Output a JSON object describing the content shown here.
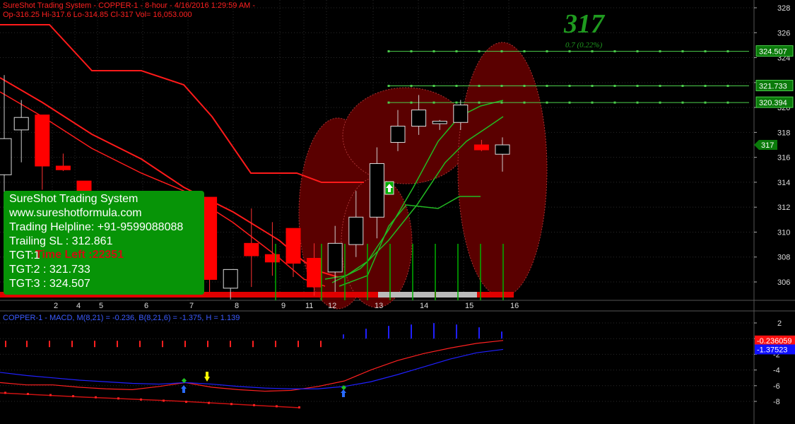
{
  "header": {
    "line1": "SureShot Trading System - COPPER-1 - 8-hour  - 4/16/2016 1:29:59 AM -",
    "line2": "Op-316.25  Hi-317.6  Lo-314.85  Cl-317  Vol= 16,053.000"
  },
  "macd_header": "COPPER-1 - MACD, M(8,21) = -0.236, B(8,21,6) = -1.375, H = 1.139",
  "big_price": "317",
  "big_change": "0.7  (0.22%)",
  "info_box": {
    "title": "SureShot Trading System",
    "website": "www.sureshotformula.com",
    "helpline": "Trading Helpline: +91-9599088088",
    "trailing_sl": "Trailing SL : 312.861",
    "tgt1": "TGT:1",
    "tgt2": "TGT:2 : 321.733",
    "tgt3": "TGT:3 : 324.507",
    "time_left": "Time Left :22351"
  },
  "colors": {
    "bullish": "#00aa00",
    "bearish": "#ff0000",
    "background": "#000000",
    "macd_line": "#ff2020",
    "signal_line": "#2020ff"
  },
  "chart_data": [
    {
      "type": "candlestick",
      "title": "SureShot Trading System - COPPER-1 - 8-hour",
      "x_labels": [
        "2",
        "4",
        "5",
        "6",
        "7",
        "8",
        "9",
        "11",
        "12",
        "13",
        "14",
        "15",
        "16"
      ],
      "y_ticks": [
        "306",
        "308",
        "310",
        "312",
        "314",
        "316",
        "318",
        "320",
        "322",
        "324",
        "326",
        "328"
      ],
      "ylim": [
        304.5,
        328.5
      ],
      "grid": true,
      "candles": [
        {
          "o": 314.6,
          "h": 322.6,
          "l": 312.6,
          "c": 317.5
        },
        {
          "o": 318.2,
          "h": 320.6,
          "l": 315.6,
          "c": 319.2
        },
        {
          "o": 319.4,
          "h": 319.4,
          "l": 313.4,
          "c": 315.3
        },
        {
          "o": 315.3,
          "h": 316.3,
          "l": 314.9,
          "c": 315.0
        },
        {
          "o": 314.1,
          "h": 314.1,
          "l": 310.8,
          "c": 311.2
        },
        {
          "o": 312.3,
          "h": 312.3,
          "l": 310.2,
          "c": 311.4
        },
        {
          "o": 311.1,
          "h": 311.1,
          "l": 311.0,
          "c": 311.1
        },
        {
          "o": 310.9,
          "h": 312.1,
          "l": 309.3,
          "c": 310.8
        },
        {
          "o": 312.1,
          "h": 312.4,
          "l": 311.4,
          "c": 311.3
        },
        {
          "o": 310.7,
          "h": 311.5,
          "l": 310.6,
          "c": 311.1
        },
        {
          "o": 312.8,
          "h": 312.8,
          "l": 305.2,
          "c": 306.2
        },
        {
          "o": 305.5,
          "h": 306.8,
          "l": 304.6,
          "c": 307.0
        },
        {
          "o": 309.1,
          "h": 311.9,
          "l": 305.6,
          "c": 308.1
        },
        {
          "o": 308.2,
          "h": 310.8,
          "l": 306.5,
          "c": 307.6
        },
        {
          "o": 310.3,
          "h": 310.3,
          "l": 306.4,
          "c": 307.5
        },
        {
          "o": 307.9,
          "h": 309.1,
          "l": 304.9,
          "c": 305.6
        },
        {
          "o": 306.8,
          "h": 310.5,
          "l": 305.2,
          "c": 309.1
        },
        {
          "o": 309.0,
          "h": 313.3,
          "l": 308.0,
          "c": 311.2
        },
        {
          "o": 311.2,
          "h": 316.8,
          "l": 309.5,
          "c": 315.5
        },
        {
          "o": 317.2,
          "h": 319.8,
          "l": 316.5,
          "c": 318.5
        },
        {
          "o": 318.5,
          "h": 321.0,
          "l": 317.8,
          "c": 319.8
        },
        {
          "o": 318.7,
          "h": 319.0,
          "l": 318.2,
          "c": 318.9
        },
        {
          "o": 318.8,
          "h": 320.6,
          "l": 318.2,
          "c": 320.2
        },
        {
          "o": 317.0,
          "h": 317.4,
          "l": 316.5,
          "c": 316.6
        },
        {
          "o": 316.25,
          "h": 317.6,
          "l": 314.85,
          "c": 317.0
        }
      ],
      "resistance_lines": [
        {
          "name": "TGT:3",
          "value": 324.507
        },
        {
          "name": "TGT:2",
          "value": 321.733
        },
        {
          "name": "TGT:1",
          "value": 320.394
        }
      ],
      "price_tags": [
        "324.507",
        "321.733",
        "320.394",
        "317"
      ]
    },
    {
      "type": "line",
      "title": "COPPER-1 - MACD, M(8,21)",
      "y_ticks": [
        "2",
        "0",
        "-2",
        "-4",
        "-6",
        "-8"
      ],
      "ylim": [
        -9,
        3
      ],
      "series": [
        {
          "name": "M",
          "values": [
            -5.6,
            -5.9,
            -5.9,
            -6.2,
            -6.4,
            -6.5,
            -6.1,
            -5.6,
            -6.2,
            -6.5,
            -6.7,
            -6.6,
            -6.1,
            -5.4,
            -4.0,
            -2.8,
            -1.9,
            -1.2,
            -0.6,
            -0.236
          ]
        },
        {
          "name": "B",
          "values": [
            -4.3,
            -4.7,
            -5.0,
            -5.3,
            -5.5,
            -5.7,
            -5.8,
            -5.6,
            -5.8,
            -6.1,
            -6.3,
            -6.4,
            -6.4,
            -6.1,
            -5.5,
            -4.6,
            -3.6,
            -2.6,
            -1.8,
            -1.375
          ]
        }
      ],
      "value_tags": [
        "-0.236059",
        "-1.37523"
      ]
    }
  ]
}
